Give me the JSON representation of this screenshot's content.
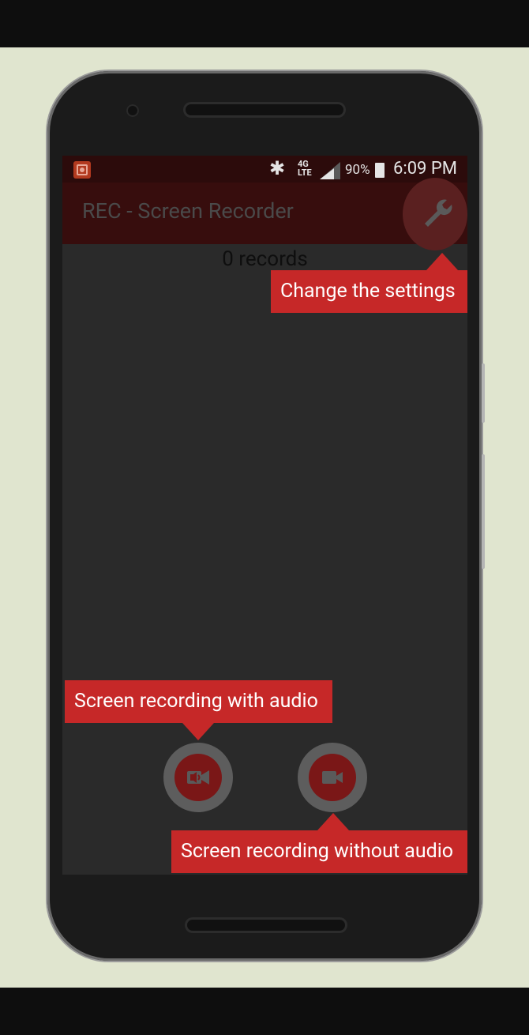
{
  "status_bar": {
    "battery_percent": "90%",
    "time": "6:09 PM"
  },
  "app_bar": {
    "title": "REC - Screen Recorder"
  },
  "main": {
    "records_count": "0 records"
  },
  "tooltips": {
    "settings": "Change the settings",
    "record_with_audio": "Screen recording with audio",
    "record_without_audio": "Screen recording without audio"
  },
  "colors": {
    "accent": "#c62828",
    "background": "#e0e5cf",
    "screen_dim": "#2a2a2a"
  }
}
